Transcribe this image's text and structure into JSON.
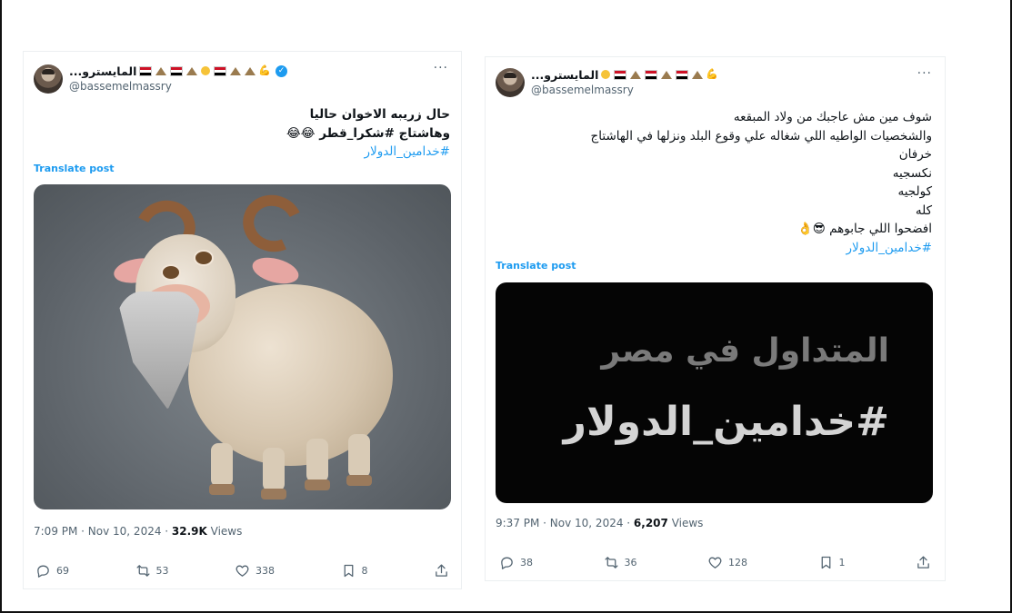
{
  "left_post": {
    "display_name": "...المايسترو",
    "handle": "@bassemelmassry",
    "text_lines": [
      "حال زريبه الاخوان حاليا",
      "وهاشتاج #شكرا_قطر 😂😂"
    ],
    "hashtag": "#خدامين_الدولار",
    "translate_label": "Translate post",
    "time": "7:09 PM · Nov 10, 2024 · ",
    "views_count": "32.9K",
    "views_label": " Views",
    "replies": "69",
    "reposts": "53",
    "likes": "338",
    "bookmarks": "8"
  },
  "right_post": {
    "display_name": "...المايسترو",
    "handle": "@bassemelmassry",
    "text_lines": [
      "شوف مين مش عاجبك من ولاد المبقعه",
      "والشخصيات الواطيه اللي شغاله علي وقوع البلد ونزلها في الهاشتاج",
      "خرفان",
      "نكسجيه",
      "كولجيه",
      "كله",
      "افضحوا اللي جابوهم 😎👌"
    ],
    "hashtag": "#خدامين_الدولار",
    "translate_label": "Translate post",
    "image_line1": "المتداول في مصر",
    "image_line2": "#خدامين_الدولار",
    "time": "9:37 PM · Nov 10, 2024 · ",
    "views_count": "6,207",
    "views_label": " Views",
    "replies": "38",
    "reposts": "36",
    "likes": "128",
    "bookmarks": "1"
  },
  "icons": {
    "more": "···",
    "muscle": "💪",
    "verified_check": "✓"
  },
  "colors": {
    "link_blue": "#1d9bf0",
    "secondary_text": "#536471"
  }
}
